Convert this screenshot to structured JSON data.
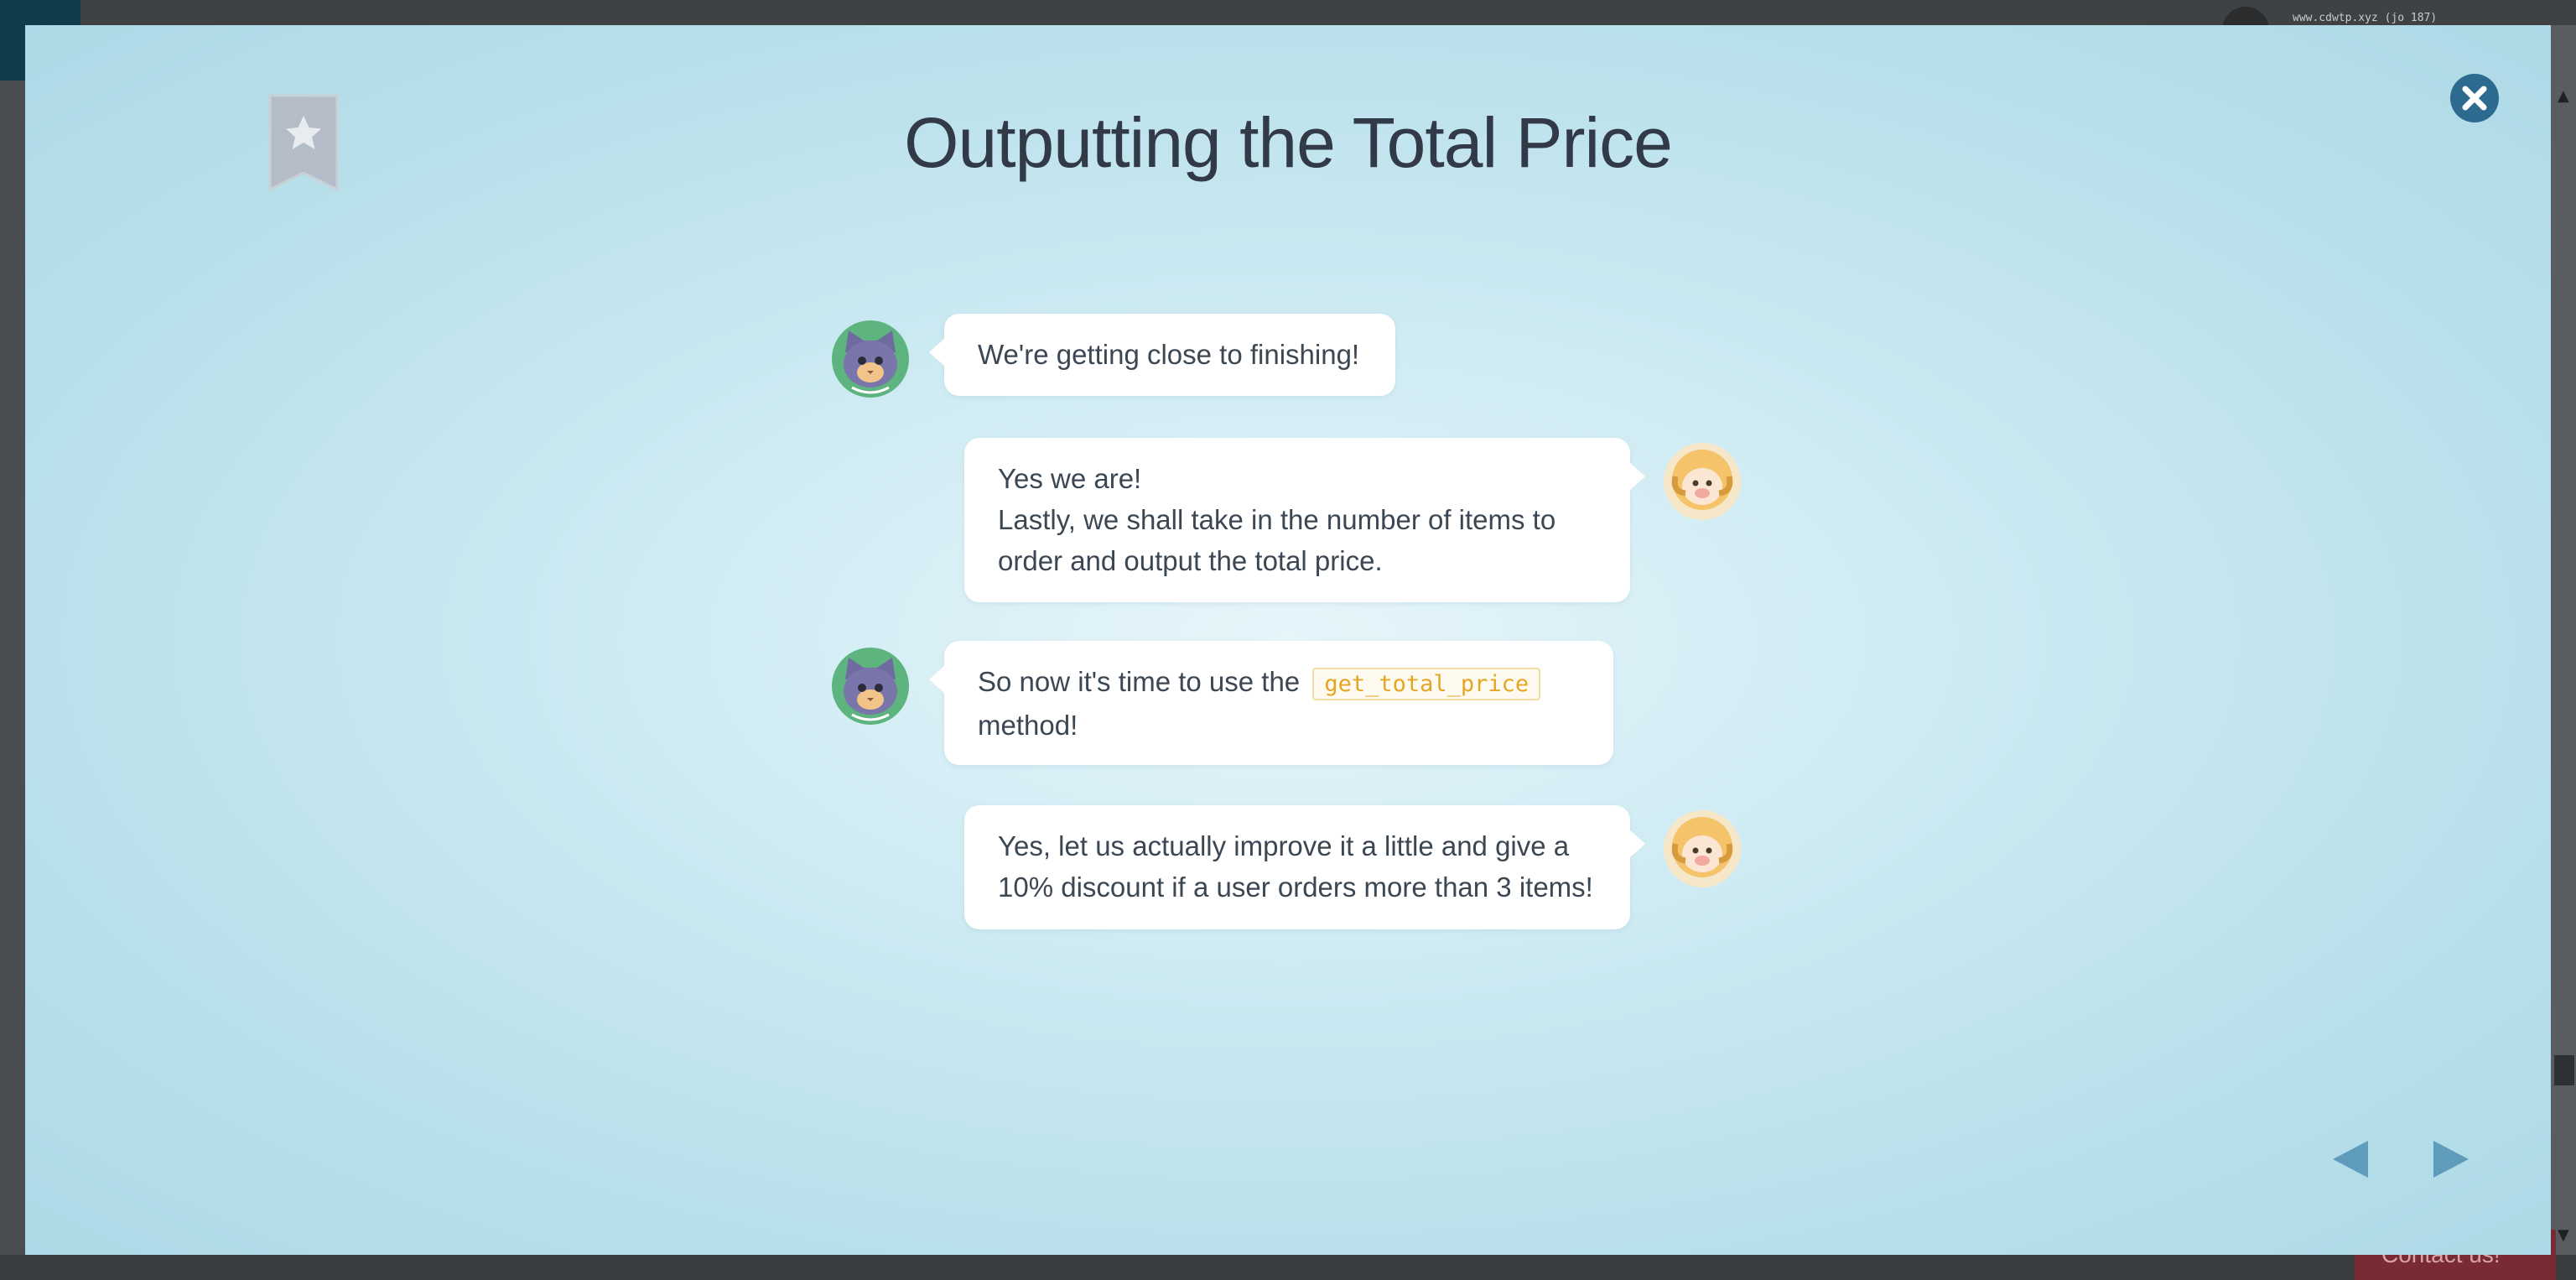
{
  "background": {
    "url_text": "www.cdwtp.xyz (jo 187)",
    "contact_label": "Contact us!"
  },
  "modal": {
    "title": "Outputting the Total Price",
    "messages": [
      {
        "speaker": "cat",
        "lines": [
          "We're getting close to finishing!"
        ]
      },
      {
        "speaker": "sheep",
        "lines": [
          "Yes we are!",
          "Lastly, we shall take in the number of items to",
          "order and output the total price."
        ]
      },
      {
        "speaker": "cat",
        "before_code": "So now it's time to use the",
        "code": "get_total_price",
        "after_code": "method!"
      },
      {
        "speaker": "sheep",
        "lines": [
          "Yes, let us actually improve it a little and give a",
          "10% discount if a user orders more than 3 items!"
        ]
      }
    ]
  },
  "icons": {
    "bookmark": "bookmark-star-icon",
    "close": "close-icon",
    "prev": "triangle-left-icon",
    "next": "triangle-right-icon"
  },
  "colors": {
    "accent_blue": "#2c6a8f",
    "nav_arrow": "#5f9bbb",
    "code_text": "#e4a524",
    "title_text": "#313a46"
  }
}
